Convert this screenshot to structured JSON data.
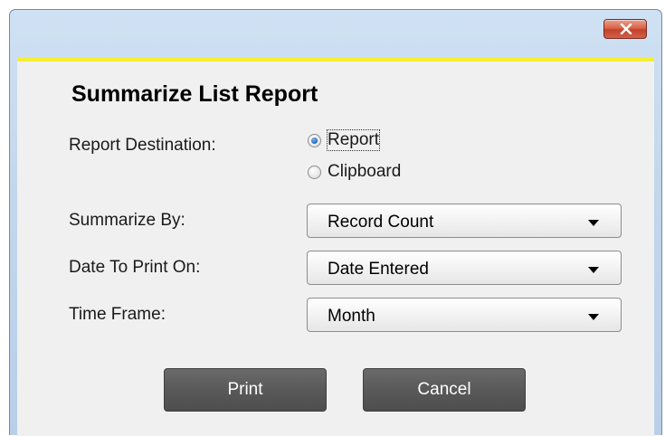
{
  "window": {
    "close_icon": "close-x-icon",
    "accent_bar_color": "#f6ee34",
    "close_button_color": "#d0634a"
  },
  "dialog": {
    "title": "Summarize List Report"
  },
  "report_destination": {
    "label": "Report Destination:",
    "options": [
      {
        "label": "Report",
        "selected": true
      },
      {
        "label": "Clipboard",
        "selected": false
      }
    ]
  },
  "summarize_by": {
    "label": "Summarize By:",
    "value": "Record Count"
  },
  "date_to_print_on": {
    "label": "Date To Print On:",
    "value": "Date Entered"
  },
  "time_frame": {
    "label": "Time Frame:",
    "value": "Month"
  },
  "buttons": {
    "print": "Print",
    "cancel": "Cancel"
  },
  "icons": {
    "dropdown": "chevron-down-icon",
    "radio": "radio-button-icon"
  }
}
